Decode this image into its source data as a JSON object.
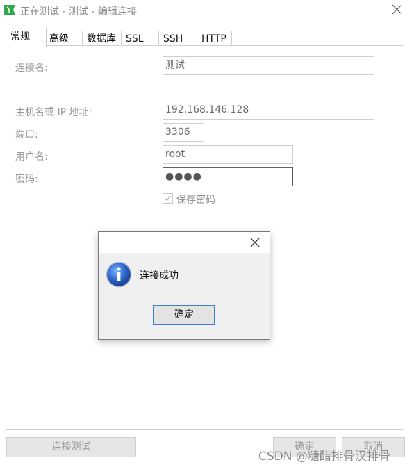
{
  "window": {
    "title": "正在测试 - 测试 - 编辑连接"
  },
  "tabs": [
    {
      "label": "常规",
      "active": true
    },
    {
      "label": "高级"
    },
    {
      "label": "数据库"
    },
    {
      "label": "SSL"
    },
    {
      "label": "SSH"
    },
    {
      "label": "HTTP"
    }
  ],
  "form": {
    "connection_name": {
      "label": "连接名:",
      "value": "测试"
    },
    "host": {
      "label": "主机名或 IP 地址:",
      "value": "192.168.146.128"
    },
    "port": {
      "label": "端口:",
      "value": "3306"
    },
    "username": {
      "label": "用户名:",
      "value": "root"
    },
    "password": {
      "label": "密码:",
      "value": "●●●●"
    },
    "save_password": {
      "label": "保存密码",
      "checked": true
    }
  },
  "footer": {
    "test_label": "连接测试",
    "ok_label": "确定",
    "cancel_label": "取消"
  },
  "watermark": "CSDN @糖醋排骨汉排骨",
  "dialog": {
    "message": "连接成功",
    "ok_label": "确定",
    "icon": "info-icon"
  },
  "colors": {
    "accent": "#3c7fd4",
    "app_icon": "#2ea84a"
  }
}
